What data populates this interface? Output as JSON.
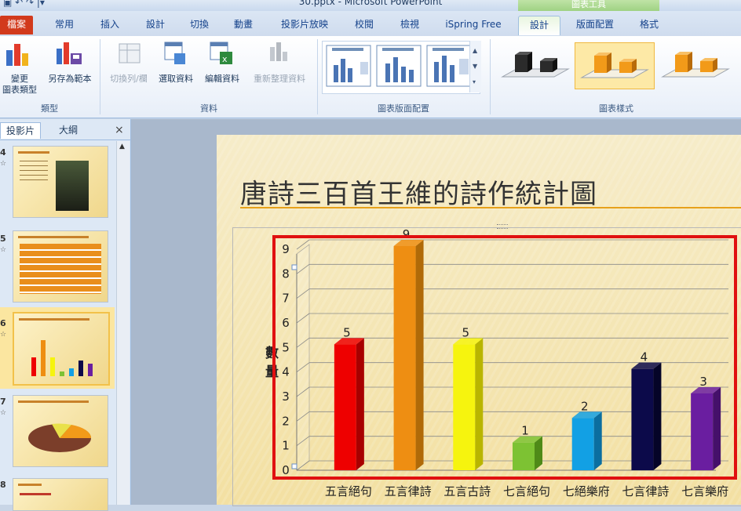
{
  "titlebar": {
    "quick_access": "▣ ↶ ↷ |▾",
    "title": "30.pptx - Microsoft PowerPoint",
    "context_group": "圖表工具"
  },
  "tabs": [
    {
      "label": "檔案"
    },
    {
      "label": "常用"
    },
    {
      "label": "插入"
    },
    {
      "label": "設計"
    },
    {
      "label": "切換"
    },
    {
      "label": "動畫"
    },
    {
      "label": "投影片放映"
    },
    {
      "label": "校閱"
    },
    {
      "label": "檢視"
    },
    {
      "label": "iSpring Free"
    },
    {
      "label": "設計"
    },
    {
      "label": "版面配置"
    },
    {
      "label": "格式"
    }
  ],
  "ribbon": {
    "change_type_label": "變更\n圖表類型",
    "save_template_label": "另存為範本",
    "group_type": "類型",
    "switch_rowcol_label": "切換列/欄",
    "select_data_label": "選取資料",
    "edit_data_label": "編輯資料",
    "refresh_data_label": "重新整理資料",
    "group_data": "資料",
    "group_layouts": "圖表版面配置",
    "group_styles": "圖表樣式"
  },
  "left_panel": {
    "tab_slides": "投影片",
    "tab_outline": "大綱",
    "close": "×",
    "slide_numbers": [
      "4",
      "5",
      "6",
      "7",
      "8"
    ]
  },
  "slide": {
    "title": "唐詩三百首王維的詩作統計圖",
    "y_axis_label": "數量"
  },
  "chart_data": {
    "type": "bar",
    "title": "",
    "ylabel": "數量",
    "ylim": [
      0,
      9
    ],
    "yticks": [
      0,
      1,
      2,
      3,
      4,
      5,
      6,
      7,
      8,
      9
    ],
    "categories": [
      "五言絕句",
      "五言律詩",
      "五言古詩",
      "七言絕句",
      "七絕樂府",
      "七言律詩",
      "七言樂府"
    ],
    "values": [
      5,
      9,
      5,
      1,
      2,
      4,
      3
    ],
    "colors": [
      "#ee0000",
      "#ee8e12",
      "#f6f40e",
      "#7dc233",
      "#12a0e4",
      "#0c0a4a",
      "#6a1ea0"
    ],
    "colors_dark": [
      "#a80000",
      "#b06a08",
      "#b9b500",
      "#4f8a18",
      "#0b6ea0",
      "#050428",
      "#45106a"
    ]
  }
}
